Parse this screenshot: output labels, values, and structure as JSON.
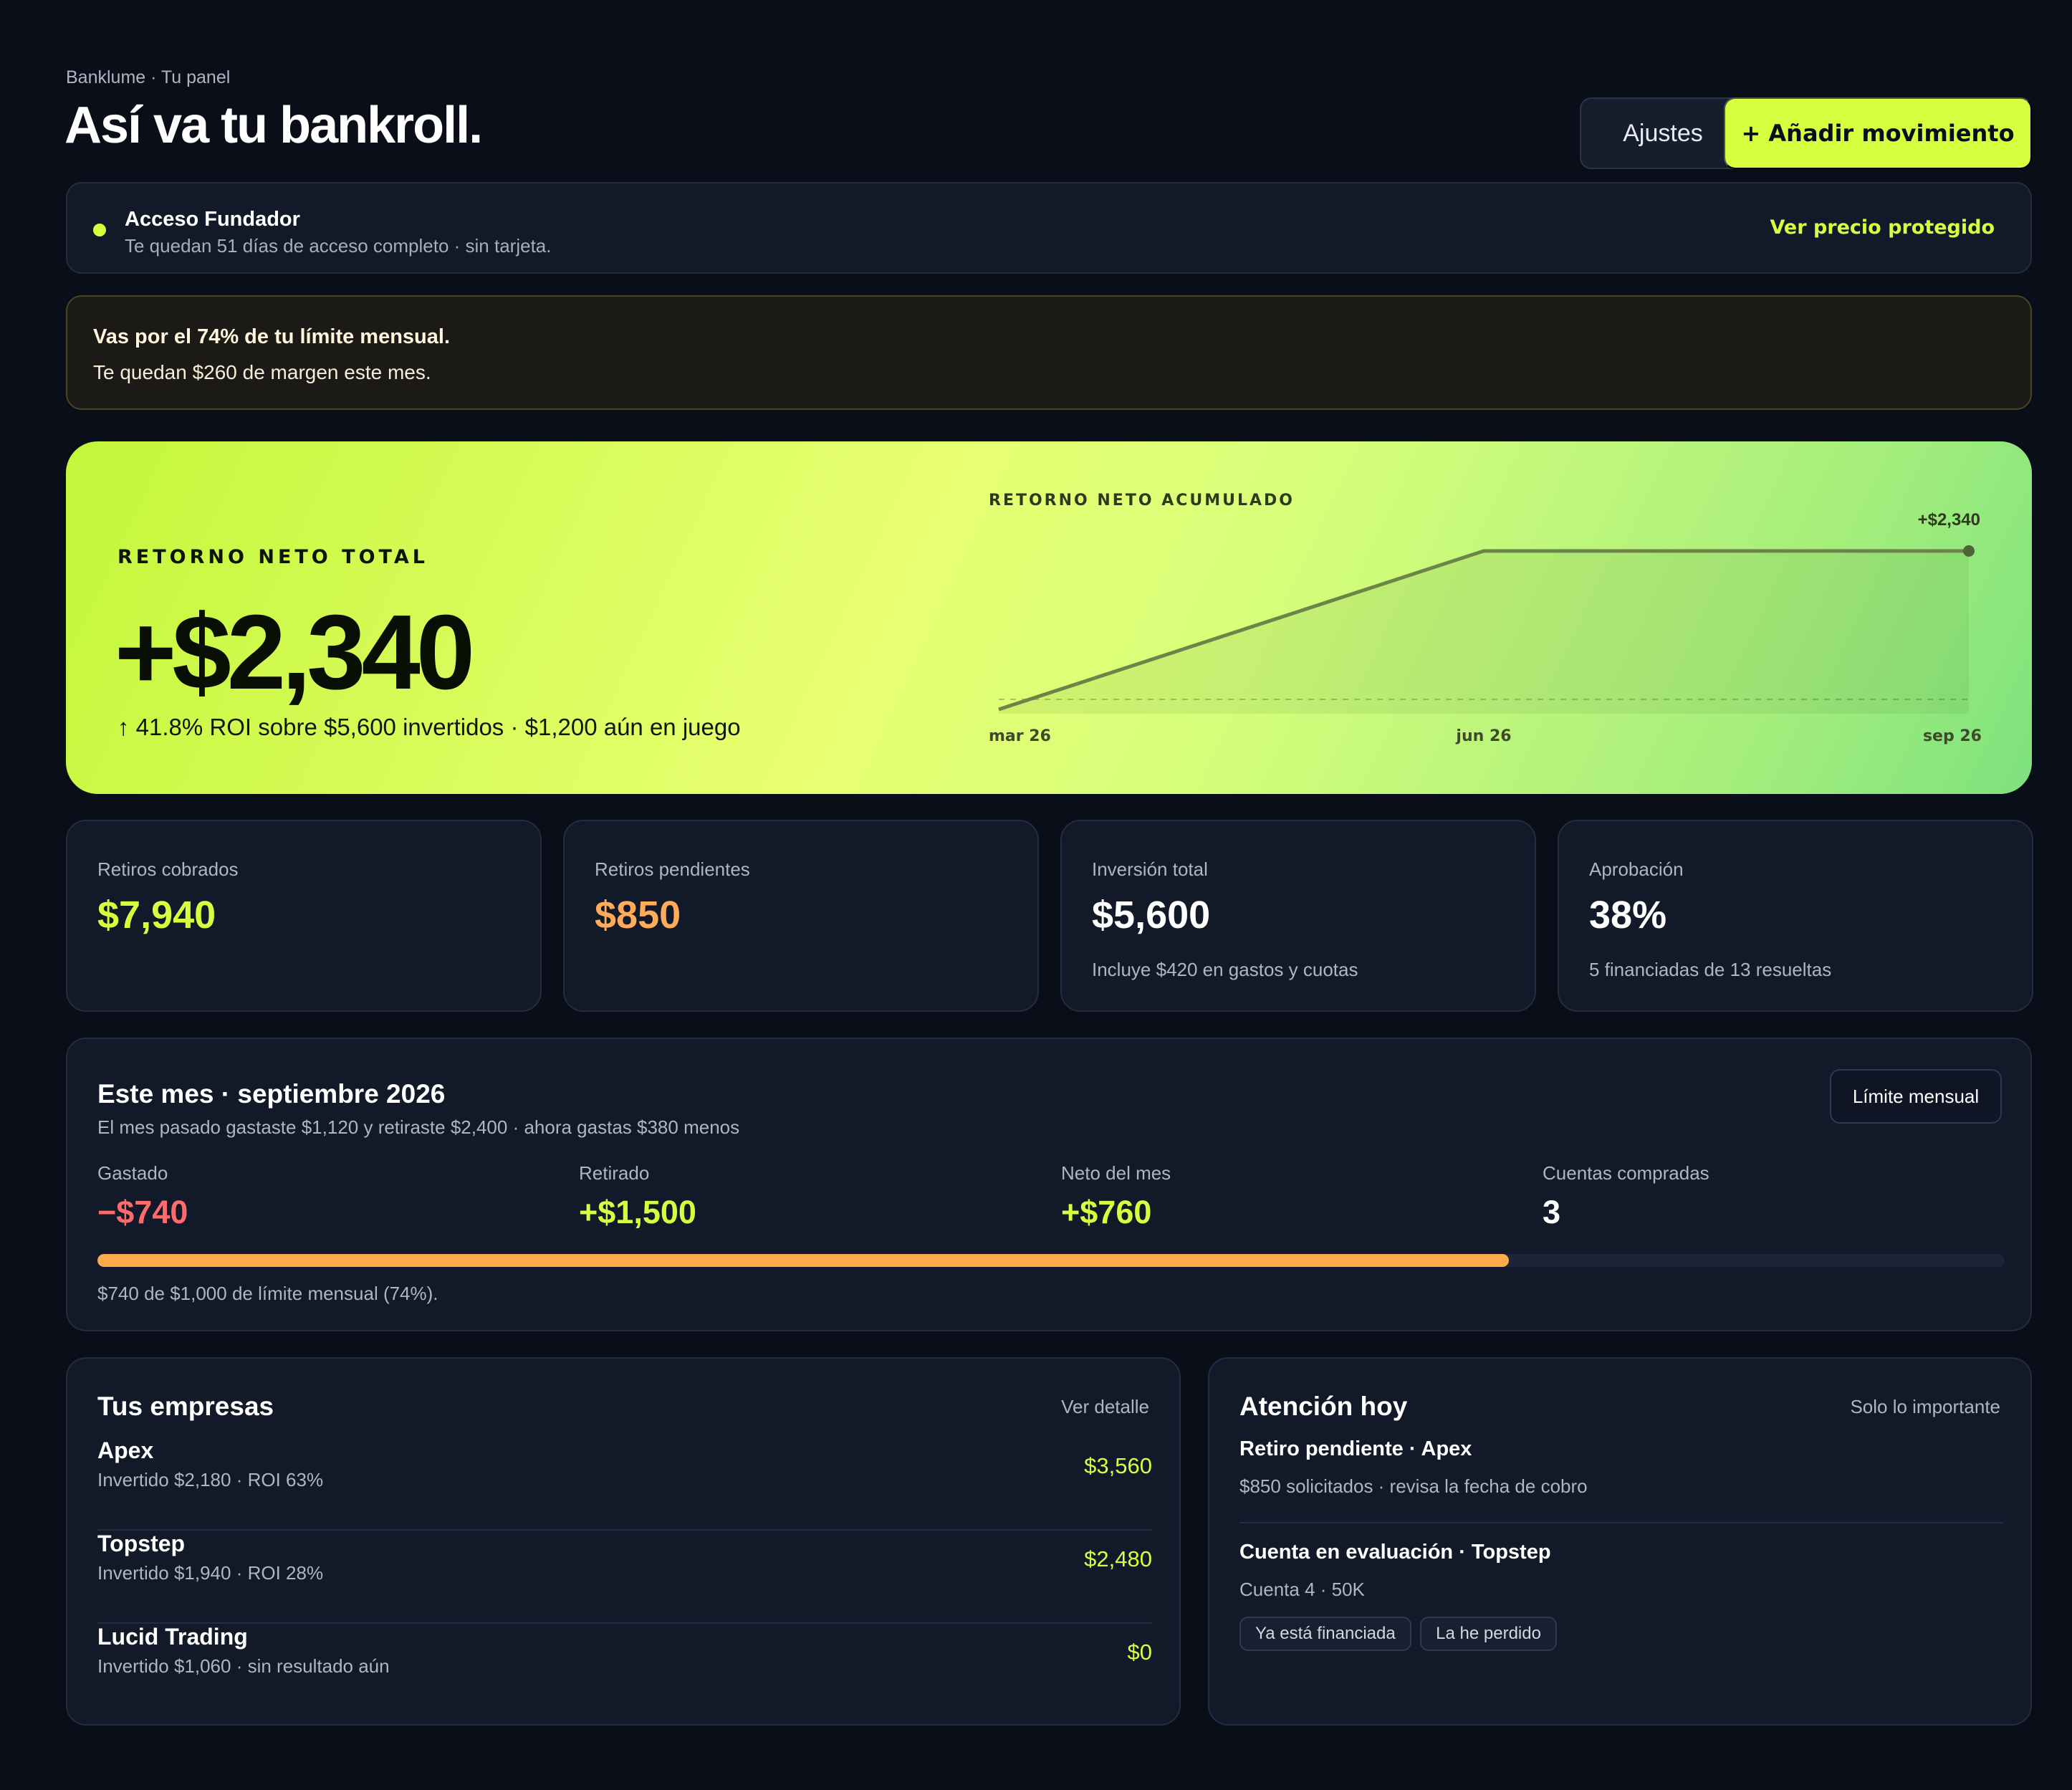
{
  "header": {
    "breadcrumb": "Banklume · Tu panel",
    "title": "Así va tu bankroll.",
    "settings_label": "Ajustes",
    "add_label": "+ Añadir movimiento"
  },
  "founder": {
    "title": "Acceso Fundador",
    "subtitle": "Te quedan 51 días de acceso completo · sin tarjeta.",
    "link": "Ver precio protegido"
  },
  "warning": {
    "title": "Vas por el 74% de tu límite mensual.",
    "subtitle": "Te quedan $260 de margen este mes."
  },
  "hero": {
    "label": "RETORNO NETO TOTAL",
    "value": "+$2,340",
    "roi": "↑ 41.8% ROI sobre $5,600 invertidos · $1,200 aún en juego"
  },
  "chart_data": {
    "type": "area",
    "title": "RETORNO NETO ACUMULADO",
    "x": [
      "mar 26",
      "jun 26",
      "sep 26"
    ],
    "values": [
      0,
      2340,
      2340
    ],
    "end_label": "+$2,340",
    "ylim": [
      0,
      2600
    ],
    "grid": false,
    "baseline_dashed": true
  },
  "stats": [
    {
      "label": "Retiros cobrados",
      "value": "$7,940",
      "note": "",
      "color": "#d6ff3f"
    },
    {
      "label": "Retiros pendientes",
      "value": "$850",
      "note": "",
      "color": "#ffab5a"
    },
    {
      "label": "Inversión total",
      "value": "$5,600",
      "note": "Incluye $420 en gastos y cuotas",
      "color": "#ffffff"
    },
    {
      "label": "Aprobación",
      "value": "38%",
      "note": "5 financiadas de 13 resueltas",
      "color": "#ffffff"
    }
  ],
  "month": {
    "title": "Este mes · septiembre 2026",
    "subtitle": "El mes pasado gastaste $1,120 y retiraste $2,400 · ahora gastas $380 menos",
    "limit_button": "Límite mensual",
    "metrics": [
      {
        "label": "Gastado",
        "value": "−$740",
        "color": "#ff6b6b"
      },
      {
        "label": "Retirado",
        "value": "+$1,500",
        "color": "#d6ff3f"
      },
      {
        "label": "Neto del mes",
        "value": "+$760",
        "color": "#d6ff3f"
      },
      {
        "label": "Cuentas compradas",
        "value": "3",
        "color": "#ffffff"
      }
    ],
    "progress": 0.74,
    "progress_note": "$740 de $1,000 de límite mensual (74%)."
  },
  "companies": {
    "title": "Tus empresas",
    "link": "Ver detalle",
    "items": [
      {
        "name": "Apex",
        "meta": "Invertido $2,180 · ROI 63%",
        "amount": "$3,560"
      },
      {
        "name": "Topstep",
        "meta": "Invertido $1,940 · ROI 28%",
        "amount": "$2,480"
      },
      {
        "name": "Lucid Trading",
        "meta": "Invertido $1,060 · sin resultado aún",
        "amount": "$0"
      }
    ]
  },
  "attention": {
    "title": "Atención hoy",
    "link": "Solo lo importante",
    "items": [
      {
        "title": "Retiro pendiente · Apex",
        "subtitle": "$850 solicitados · revisa la fecha de cobro"
      },
      {
        "title": "Cuenta en evaluación · Topstep",
        "subtitle": "Cuenta 4 · 50K"
      }
    ],
    "tags": [
      "Ya está financiada",
      "La he perdido"
    ]
  }
}
